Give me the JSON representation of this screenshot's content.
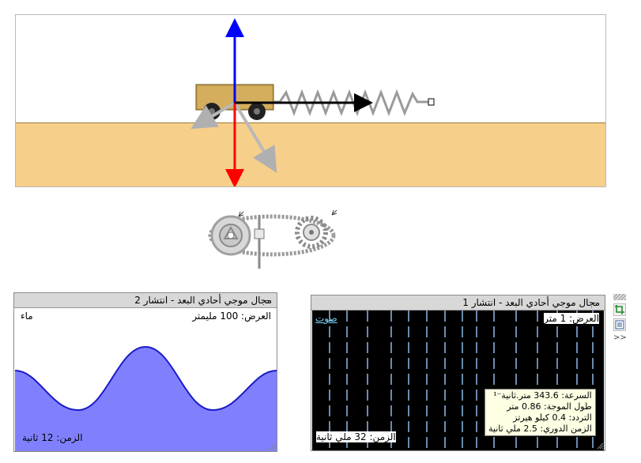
{
  "panel_right": {
    "title": "مجال موجي أحادي البعد - انتشار 1",
    "min_label": "–",
    "width_label": "العرض: 1 متر",
    "medium_label": "صوت",
    "time_label": "الزمن: 32 ملي ثانية",
    "info": {
      "speed": "السرعة: 343.6 متر.ثانية⁻¹",
      "wavelength": "طول الموجة: 0.86 متر",
      "frequency": "التردد: 0.4 كيلو هيرتز",
      "period": "الزمن الدوري: 2.5 ملي ثانية"
    }
  },
  "panel_left": {
    "title": "مجال موجي أحادي البعد - انتشار 2",
    "min_label": "–",
    "width_label": "العرض: 100 مليمتر",
    "medium_label": "ماء",
    "time_label": "الزمن: 12 ثانية"
  },
  "side_toolbar": {
    "expand_label": ">>"
  },
  "colors": {
    "ground": "#f6cf8a",
    "wave_fill": "#8080ff",
    "wave_line": "#1a1ac8",
    "force_up": "#0000ff",
    "force_down": "#ff0000",
    "velocity": "#000000",
    "sound_bg": "#000000",
    "sound_lines": "#8fb7e8"
  },
  "icons": [
    "crop-icon",
    "list-icon",
    "expand-icon",
    "minimize-icon",
    "resize-grip-icon",
    "gear-icon"
  ]
}
